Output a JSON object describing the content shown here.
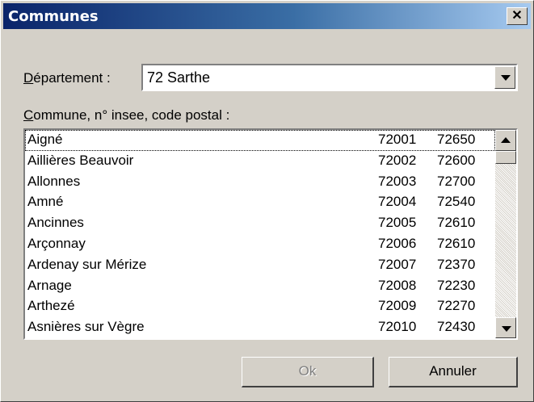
{
  "window": {
    "title": "Communes",
    "close_label": "✕"
  },
  "departement": {
    "label_prefix": "D",
    "label_rest": "épartement :",
    "value": "72  Sarthe"
  },
  "commune_list": {
    "label_prefix": "C",
    "label_rest": "ommune, n° insee, code postal :",
    "rows": [
      {
        "name": "Aigné",
        "insee": "72001",
        "cp": "72650"
      },
      {
        "name": "Aillières Beauvoir",
        "insee": "72002",
        "cp": "72600"
      },
      {
        "name": "Allonnes",
        "insee": "72003",
        "cp": "72700"
      },
      {
        "name": "Amné",
        "insee": "72004",
        "cp": "72540"
      },
      {
        "name": "Ancinnes",
        "insee": "72005",
        "cp": "72610"
      },
      {
        "name": "Arçonnay",
        "insee": "72006",
        "cp": "72610"
      },
      {
        "name": "Ardenay sur Mérize",
        "insee": "72007",
        "cp": "72370"
      },
      {
        "name": "Arnage",
        "insee": "72008",
        "cp": "72230"
      },
      {
        "name": "Arthezé",
        "insee": "72009",
        "cp": "72270"
      },
      {
        "name": "Asnières sur Vègre",
        "insee": "72010",
        "cp": "72430"
      }
    ]
  },
  "buttons": {
    "ok": "Ok",
    "cancel": "Annuler"
  }
}
